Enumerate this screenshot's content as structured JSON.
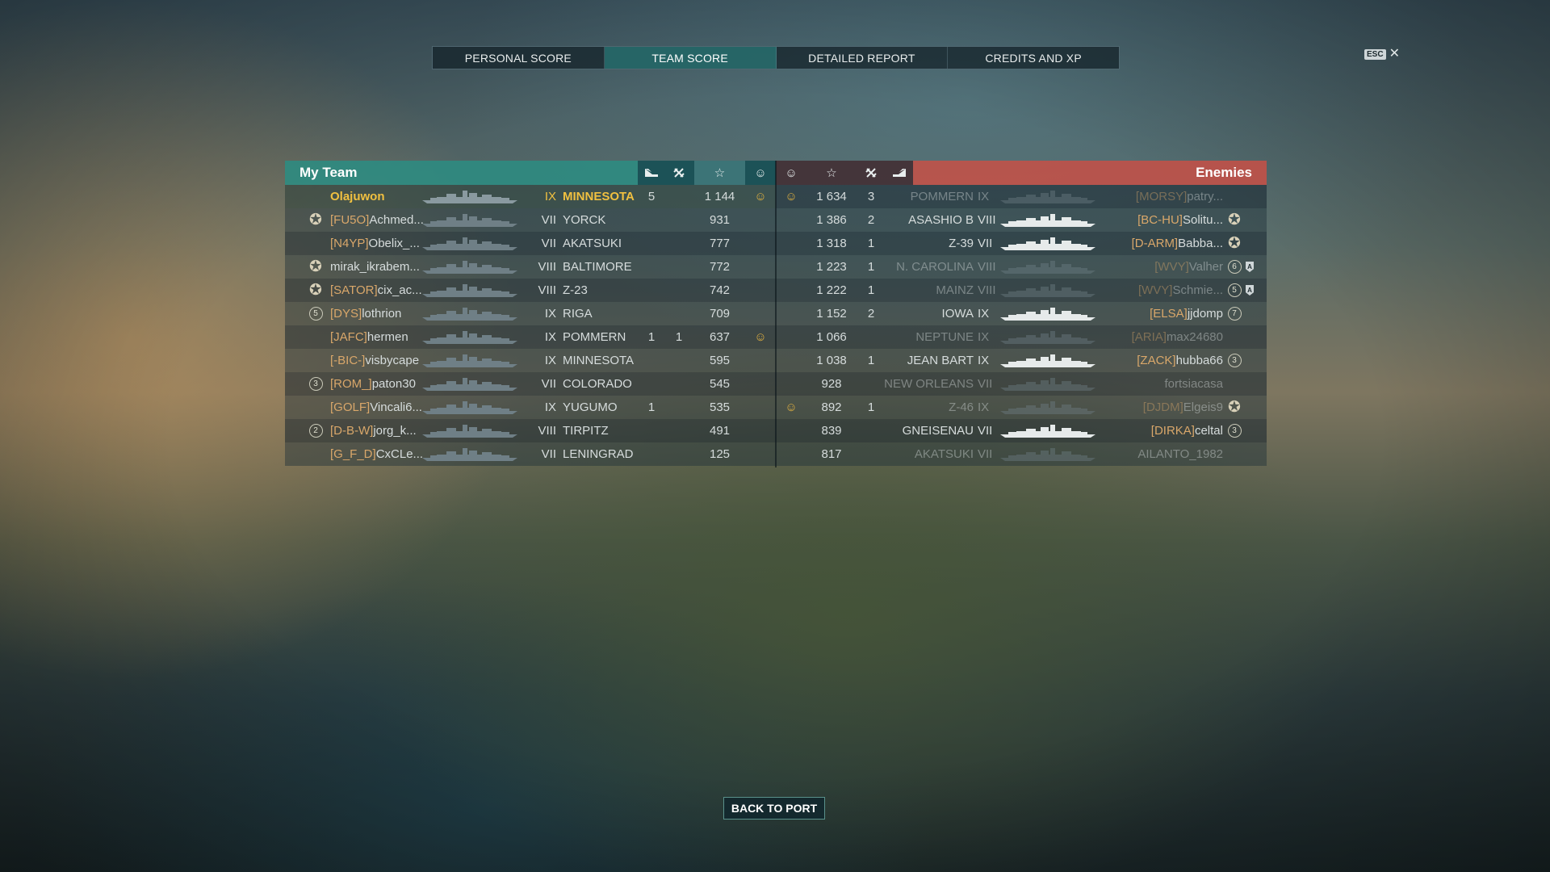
{
  "tabs": [
    "PERSONAL SCORE",
    "TEAM SCORE",
    "DETAILED REPORT",
    "CREDITS AND XP"
  ],
  "active_tab": 1,
  "esc": {
    "key": "ESC",
    "close": "✕"
  },
  "my_team": {
    "title": "My Team",
    "header_icons": [
      "planes-shot-icon",
      "kills-icon",
      "xp-star-icon",
      "ribbon-icon"
    ],
    "rows": [
      {
        "badge": "",
        "clan": "",
        "name": "Olajuwon",
        "tier": "IX",
        "ship": "MINNESOTA",
        "planes": "5",
        "kills": "",
        "xp": "1 144",
        "ribbon": true,
        "me": true,
        "dim": false
      },
      {
        "badge": "star",
        "clan": "[FU5O]",
        "name": "Achmed...",
        "tier": "VII",
        "ship": "YORCK",
        "planes": "",
        "kills": "",
        "xp": "931",
        "ribbon": false,
        "me": false,
        "dim": false
      },
      {
        "badge": "",
        "clan": "[N4YP]",
        "name": "Obelix_...",
        "tier": "VII",
        "ship": "AKATSUKI",
        "planes": "",
        "kills": "",
        "xp": "777",
        "ribbon": false,
        "me": false,
        "dim": false
      },
      {
        "badge": "star",
        "clan": "",
        "name": "mirak_ikrabem...",
        "tier": "VIII",
        "ship": "BALTIMORE",
        "planes": "",
        "kills": "",
        "xp": "772",
        "ribbon": false,
        "me": false,
        "dim": false
      },
      {
        "badge": "star",
        "clan": "[SATOR]",
        "name": "cix_ac...",
        "tier": "VIII",
        "ship": "Z-23",
        "planes": "",
        "kills": "",
        "xp": "742",
        "ribbon": false,
        "me": false,
        "dim": false
      },
      {
        "badge": "5",
        "clan": "[DYS]",
        "name": "lothrion",
        "tier": "IX",
        "ship": "RIGA",
        "planes": "",
        "kills": "",
        "xp": "709",
        "ribbon": false,
        "me": false,
        "dim": false
      },
      {
        "badge": "",
        "clan": "[JAFC]",
        "name": "hermen",
        "tier": "IX",
        "ship": "POMMERN",
        "planes": "1",
        "kills": "1",
        "xp": "637",
        "ribbon": true,
        "me": false,
        "dim": false
      },
      {
        "badge": "",
        "clan": "[-BIC-]",
        "name": "visbycape",
        "tier": "IX",
        "ship": "MINNESOTA",
        "planes": "",
        "kills": "",
        "xp": "595",
        "ribbon": false,
        "me": false,
        "dim": false
      },
      {
        "badge": "3",
        "clan": "[ROM_]",
        "name": "paton30",
        "tier": "VII",
        "ship": "COLORADO",
        "planes": "",
        "kills": "",
        "xp": "545",
        "ribbon": false,
        "me": false,
        "dim": false
      },
      {
        "badge": "",
        "clan": "[GOLF]",
        "name": "Vincali6...",
        "tier": "IX",
        "ship": "YUGUMO",
        "planes": "1",
        "kills": "",
        "xp": "535",
        "ribbon": false,
        "me": false,
        "dim": false
      },
      {
        "badge": "2",
        "clan": "[D-B-W]",
        "name": "jorg_k...",
        "tier": "VIII",
        "ship": "TIRPITZ",
        "planes": "",
        "kills": "",
        "xp": "491",
        "ribbon": false,
        "me": false,
        "dim": false
      },
      {
        "badge": "",
        "clan": "[G_F_D]",
        "name": "CxCLe...",
        "tier": "VII",
        "ship": "LENINGRAD",
        "planes": "",
        "kills": "",
        "xp": "125",
        "ribbon": false,
        "me": false,
        "dim": false
      }
    ]
  },
  "enemies": {
    "title": "Enemies",
    "header_icons": [
      "ribbon-icon",
      "xp-star-icon",
      "kills-icon",
      "planes-shot-icon"
    ],
    "rows": [
      {
        "ribbon": true,
        "xp": "1 634",
        "kills": "3",
        "ship": "POMMERN",
        "tier": "IX",
        "clan": "[MORSY]",
        "name": "patry...",
        "badge": "",
        "shield": false,
        "dim": true
      },
      {
        "ribbon": false,
        "xp": "1 386",
        "kills": "2",
        "ship": "ASASHIO B",
        "tier": "VIII",
        "clan": "[BC-HU]",
        "name": "Solitu...",
        "badge": "star",
        "shield": false,
        "dim": false
      },
      {
        "ribbon": false,
        "xp": "1 318",
        "kills": "1",
        "ship": "Z-39",
        "tier": "VII",
        "clan": "[D-ARM]",
        "name": "Babba...",
        "badge": "star",
        "shield": false,
        "dim": false
      },
      {
        "ribbon": false,
        "xp": "1 223",
        "kills": "1",
        "ship": "N. CAROLINA",
        "tier": "VIII",
        "clan": "[WVY]",
        "name": "Valher",
        "badge": "6",
        "shield": true,
        "dim": true
      },
      {
        "ribbon": false,
        "xp": "1 222",
        "kills": "1",
        "ship": "MAINZ",
        "tier": "VIII",
        "clan": "[WVY]",
        "name": "Schmie...",
        "badge": "5",
        "shield": true,
        "dim": true
      },
      {
        "ribbon": false,
        "xp": "1 152",
        "kills": "2",
        "ship": "IOWA",
        "tier": "IX",
        "clan": "[ELSA]",
        "name": "jjdomp",
        "badge": "7",
        "shield": false,
        "dim": false
      },
      {
        "ribbon": false,
        "xp": "1 066",
        "kills": "",
        "ship": "NEPTUNE",
        "tier": "IX",
        "clan": "[ARIA]",
        "name": "max24680",
        "badge": "",
        "shield": false,
        "dim": true
      },
      {
        "ribbon": false,
        "xp": "1 038",
        "kills": "1",
        "ship": "JEAN BART",
        "tier": "IX",
        "clan": "[ZACK]",
        "name": "hubba66",
        "badge": "3",
        "shield": false,
        "dim": false
      },
      {
        "ribbon": false,
        "xp": "928",
        "kills": "",
        "ship": "NEW ORLEANS",
        "tier": "VII",
        "clan": "",
        "name": "fortsiacasa",
        "badge": "",
        "shield": false,
        "dim": true
      },
      {
        "ribbon": true,
        "xp": "892",
        "kills": "1",
        "ship": "Z-46",
        "tier": "IX",
        "clan": "[DJDM]",
        "name": "Elgeis9",
        "badge": "star",
        "shield": false,
        "dim": true
      },
      {
        "ribbon": false,
        "xp": "839",
        "kills": "",
        "ship": "GNEISENAU",
        "tier": "VII",
        "clan": "[DIRKA]",
        "name": "celtal",
        "badge": "3",
        "shield": false,
        "dim": false
      },
      {
        "ribbon": false,
        "xp": "817",
        "kills": "",
        "ship": "AKATSUKI",
        "tier": "VII",
        "clan": "",
        "name": "AILANTO_1982",
        "badge": "",
        "shield": false,
        "dim": true
      }
    ]
  },
  "back_button": "BACK TO PORT"
}
